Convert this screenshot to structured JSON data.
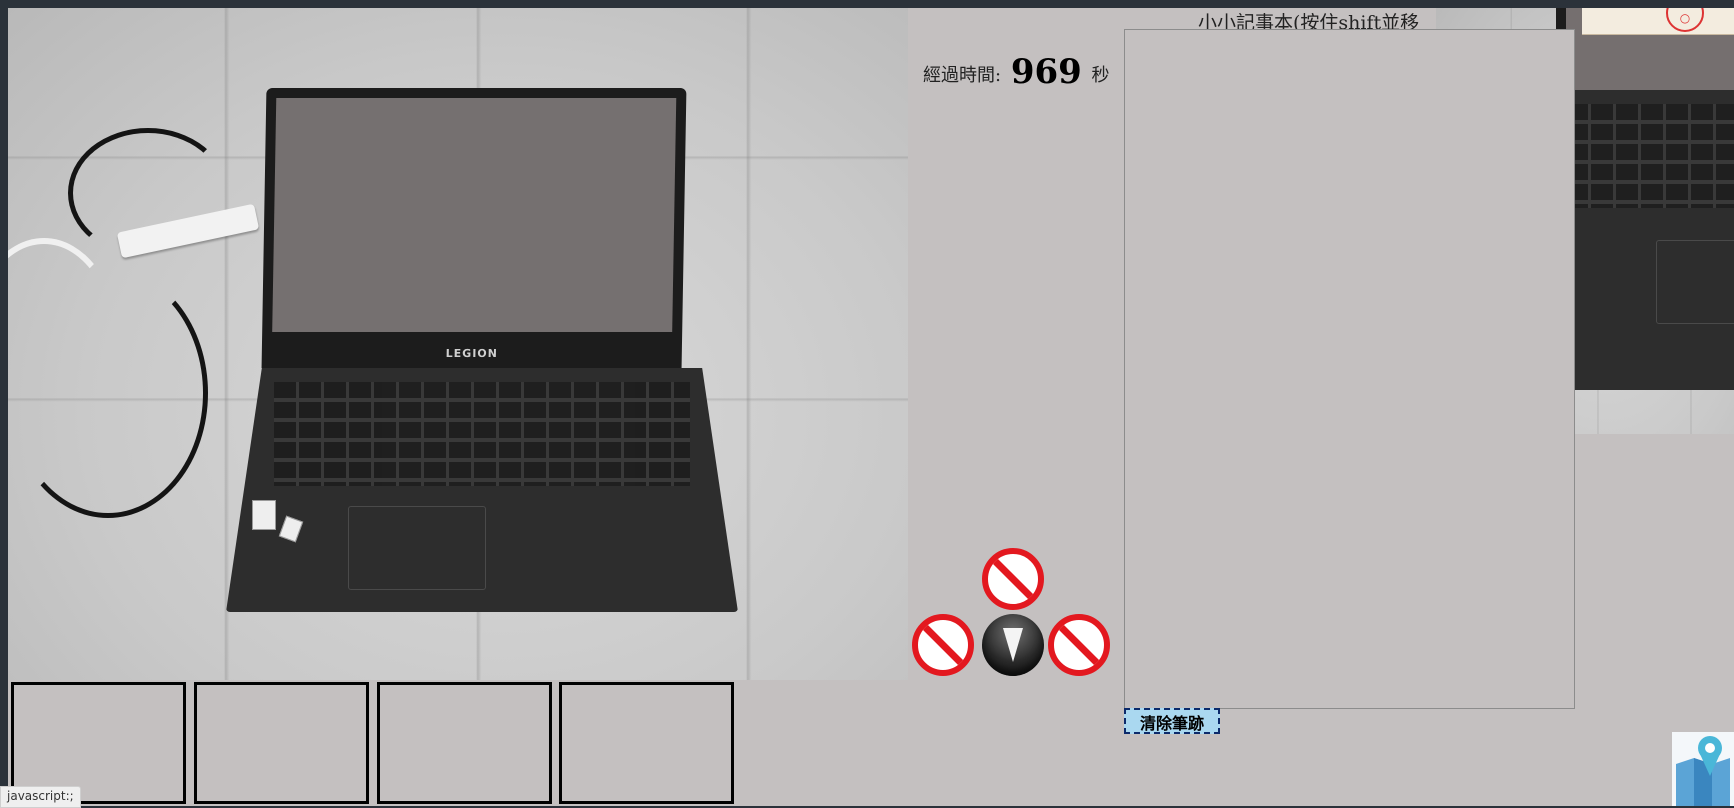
{
  "timer": {
    "label": "經過時間:",
    "value": "969",
    "unit": "秒"
  },
  "notepad": {
    "title": "小小記事本(按住shift並移"
  },
  "buttons": {
    "clear_strokes": "清除筆跡"
  },
  "photo": {
    "laptop_brand": "LEGION"
  },
  "inventory": {
    "slots": [
      "",
      "",
      "",
      ""
    ]
  },
  "navigation": {
    "up": "blocked",
    "left": "blocked",
    "right": "blocked",
    "compass": "down"
  },
  "status_bar": {
    "text": "javascript:;"
  },
  "colors": {
    "stage_bg": "#c4c0c0",
    "frame_bg": "#2b323a",
    "blocked_red": "#e3181f",
    "clear_button_bg": "#aad8f0"
  },
  "icons": {
    "blocked": "no-entry-icon",
    "compass": "compass-arrow-icon",
    "map": "map-pin-icon"
  }
}
